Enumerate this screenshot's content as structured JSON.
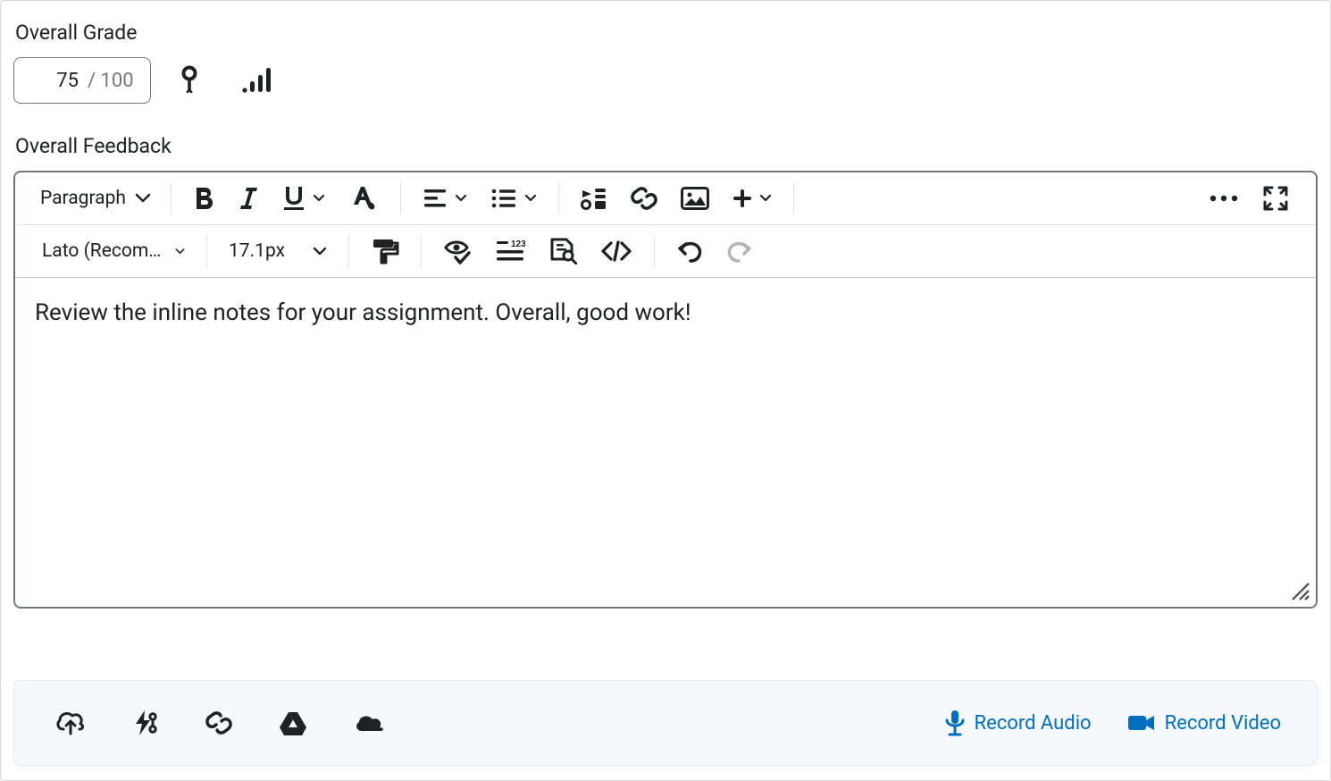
{
  "labels": {
    "overall_grade": "Overall Grade",
    "overall_feedback": "Overall Feedback"
  },
  "grade": {
    "value": "75",
    "total": "/ 100"
  },
  "toolbar": {
    "block_format": "Paragraph",
    "font": "Lato (Recommended)",
    "font_size": "17.1px"
  },
  "editor": {
    "content": "Review the inline notes for your assignment. Overall, good work!"
  },
  "attach": {
    "record_audio": "Record Audio",
    "record_video": "Record Video"
  }
}
